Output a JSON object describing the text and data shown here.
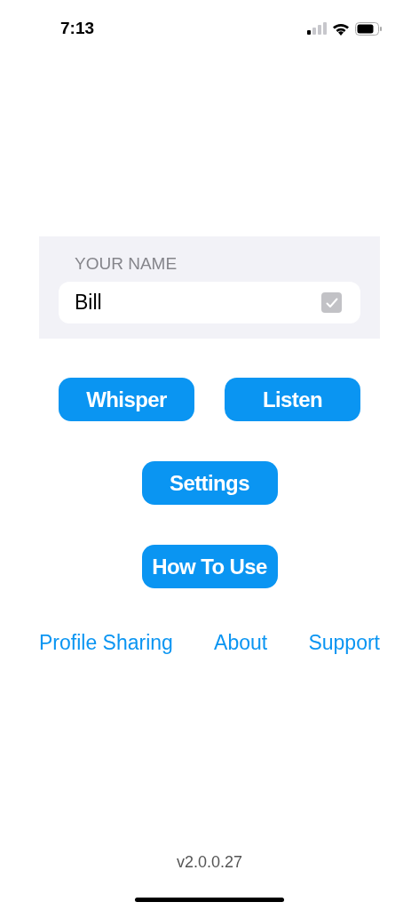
{
  "status_bar": {
    "time": "7:13"
  },
  "name_section": {
    "header": "YOUR NAME",
    "value": "Bill",
    "checked": true
  },
  "buttons": [
    {
      "label": "Whisper"
    },
    {
      "label": "Listen"
    },
    {
      "label": "Settings"
    },
    {
      "label": "How To Use"
    }
  ],
  "links": [
    {
      "label": "Profile Sharing"
    },
    {
      "label": "About"
    },
    {
      "label": "Support"
    }
  ],
  "version": "v2.0.0.27"
}
